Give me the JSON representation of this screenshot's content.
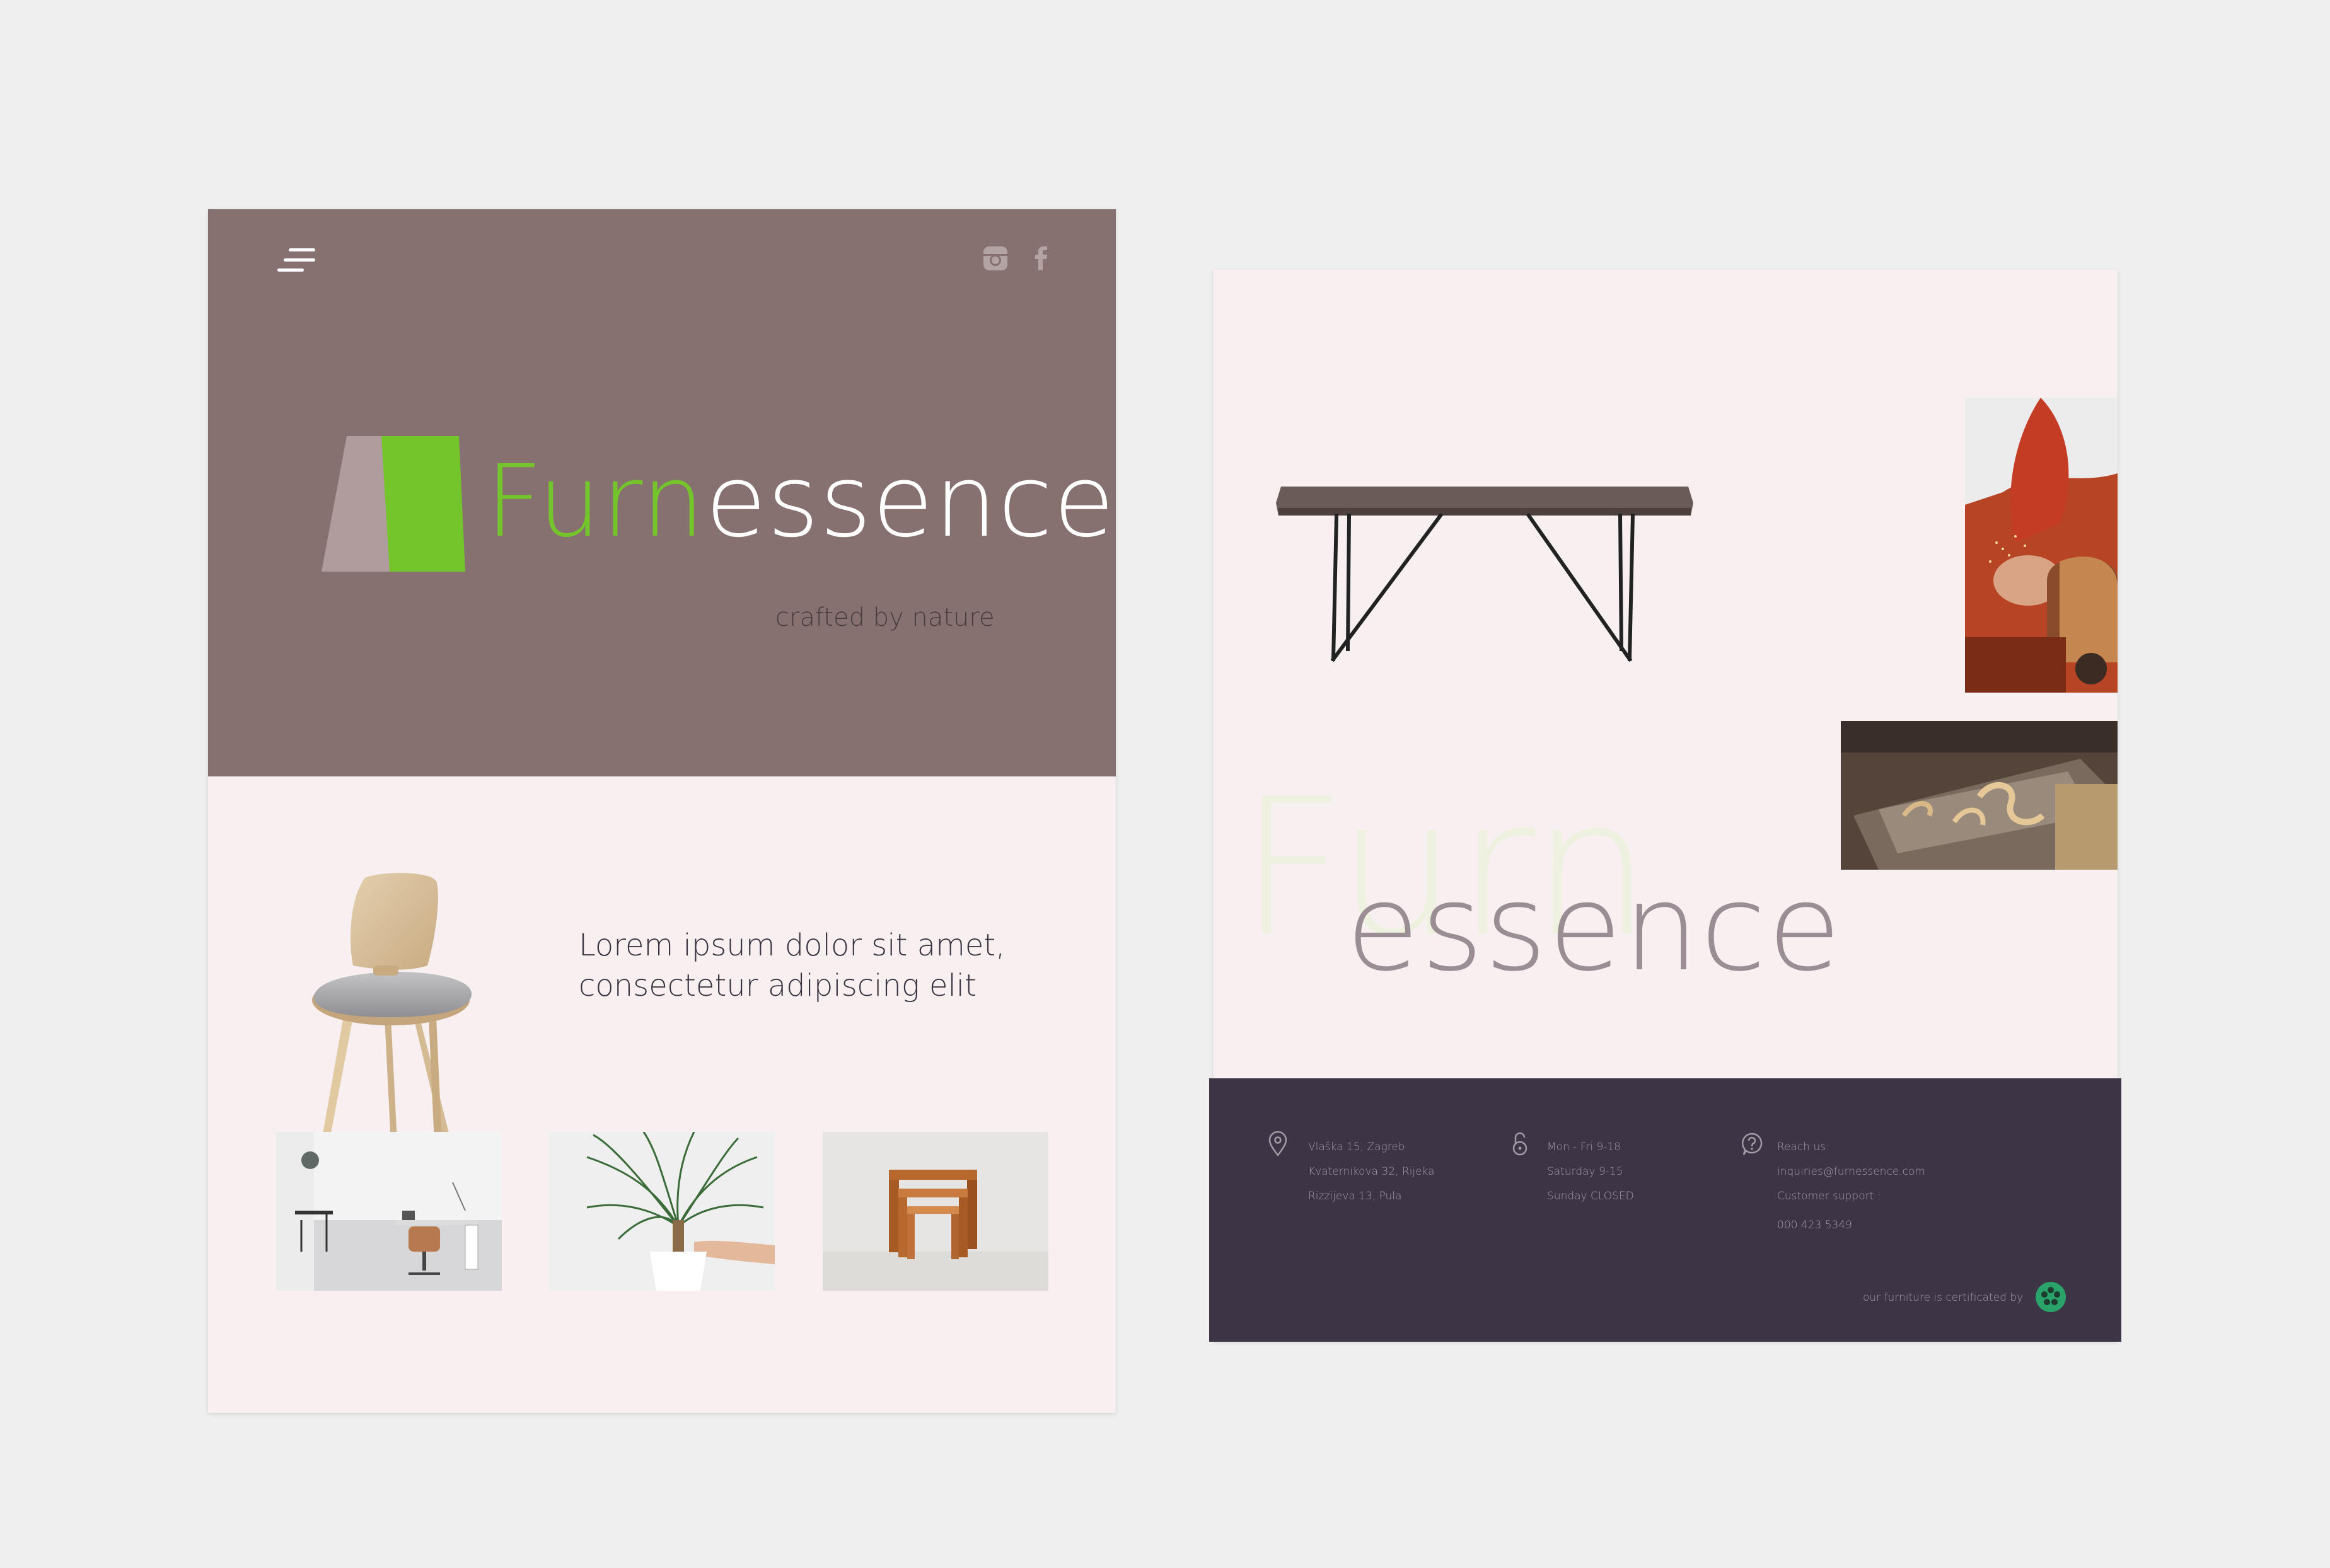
{
  "left_page": {
    "brand": {
      "part1": "Furn",
      "part2": "essence"
    },
    "tagline": "crafted by nature",
    "lorem": "Lorem ipsum dolor sit amet, consectetur adipiscing elit",
    "icons": [
      "menu-icon",
      "instagram-icon",
      "facebook-icon"
    ],
    "colors": {
      "hero": "#877070",
      "accent": "#74c42c",
      "page": "#f8f0f0"
    }
  },
  "right_page": {
    "furn_ghost": "Furn",
    "essence_big": "essence",
    "footer": {
      "addresses": [
        "Vlaška 15, Zagreb",
        "Kvaternikova 32, Rijeka",
        "Rizzijeva 13, Pula"
      ],
      "hours": [
        "Mon - Fri  9-18",
        "Saturday  9-15",
        "Sunday  CLOSED"
      ],
      "contact": [
        "Reach us:",
        "inquiries@furnessence.com",
        "Customer support :",
        "000 423 5349"
      ],
      "certified": "our furniture is certificated by",
      "icons": [
        "location-pin-icon",
        "open-lock-icon",
        "question-bubble-icon",
        "certification-badge-icon"
      ],
      "color": "#3d3445"
    }
  }
}
